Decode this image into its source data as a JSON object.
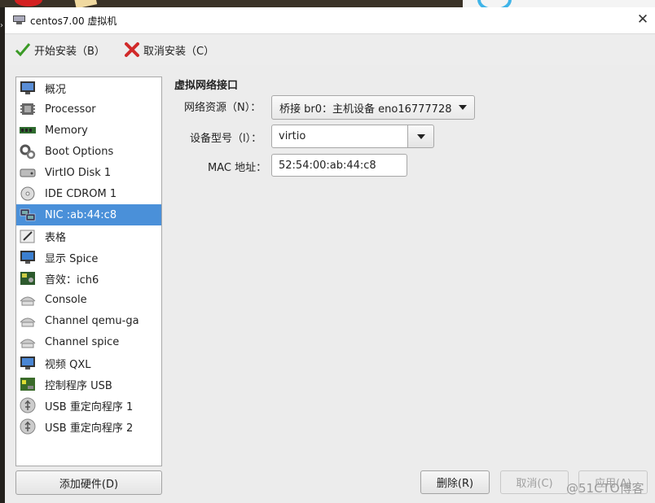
{
  "window": {
    "title": "centos7.00 虚拟机"
  },
  "toolbar": {
    "start_label": "开始安装（B）",
    "cancel_label": "取消安装（C）"
  },
  "hardware": [
    {
      "label": "概况",
      "icon": "monitor-icon"
    },
    {
      "label": "Processor",
      "icon": "cpu-chip-icon"
    },
    {
      "label": "Memory",
      "icon": "memory-stick-icon"
    },
    {
      "label": "Boot Options",
      "icon": "gears-icon"
    },
    {
      "label": "VirtIO Disk 1",
      "icon": "hard-disk-icon"
    },
    {
      "label": "IDE CDROM 1",
      "icon": "cdrom-icon"
    },
    {
      "label": "NIC :ab:44:c8",
      "icon": "network-card-icon",
      "selected": true
    },
    {
      "label": "表格",
      "icon": "tablet-pen-icon"
    },
    {
      "label": "显示 Spice",
      "icon": "display-monitor-icon"
    },
    {
      "label": "音效：ich6",
      "icon": "sound-card-icon"
    },
    {
      "label": "Console",
      "icon": "serial-port-icon"
    },
    {
      "label": "Channel qemu-ga",
      "icon": "serial-port-icon"
    },
    {
      "label": "Channel spice",
      "icon": "serial-port-icon"
    },
    {
      "label": "视频 QXL",
      "icon": "video-monitor-icon"
    },
    {
      "label": "控制程序 USB",
      "icon": "controller-card-icon"
    },
    {
      "label": "USB 重定向程序 1",
      "icon": "usb-icon"
    },
    {
      "label": "USB 重定向程序 2",
      "icon": "usb-icon"
    }
  ],
  "add_hardware_label": "添加硬件(D)",
  "nic": {
    "section_title": "虚拟网络接口",
    "source_label": "网络资源（N）：",
    "source_value": "桥接 br0：主机设备 eno16777728",
    "model_label": "设备型号（l）：",
    "model_value": "virtio",
    "mac_label": "MAC 地址：",
    "mac_value": "52:54:00:ab:44:c8"
  },
  "buttons": {
    "remove": "删除(R)",
    "cancel": "取消(C)",
    "apply": "应用(A)"
  },
  "watermark": "@51CTO博客",
  "colors": {
    "selection": "#4a90d9"
  }
}
